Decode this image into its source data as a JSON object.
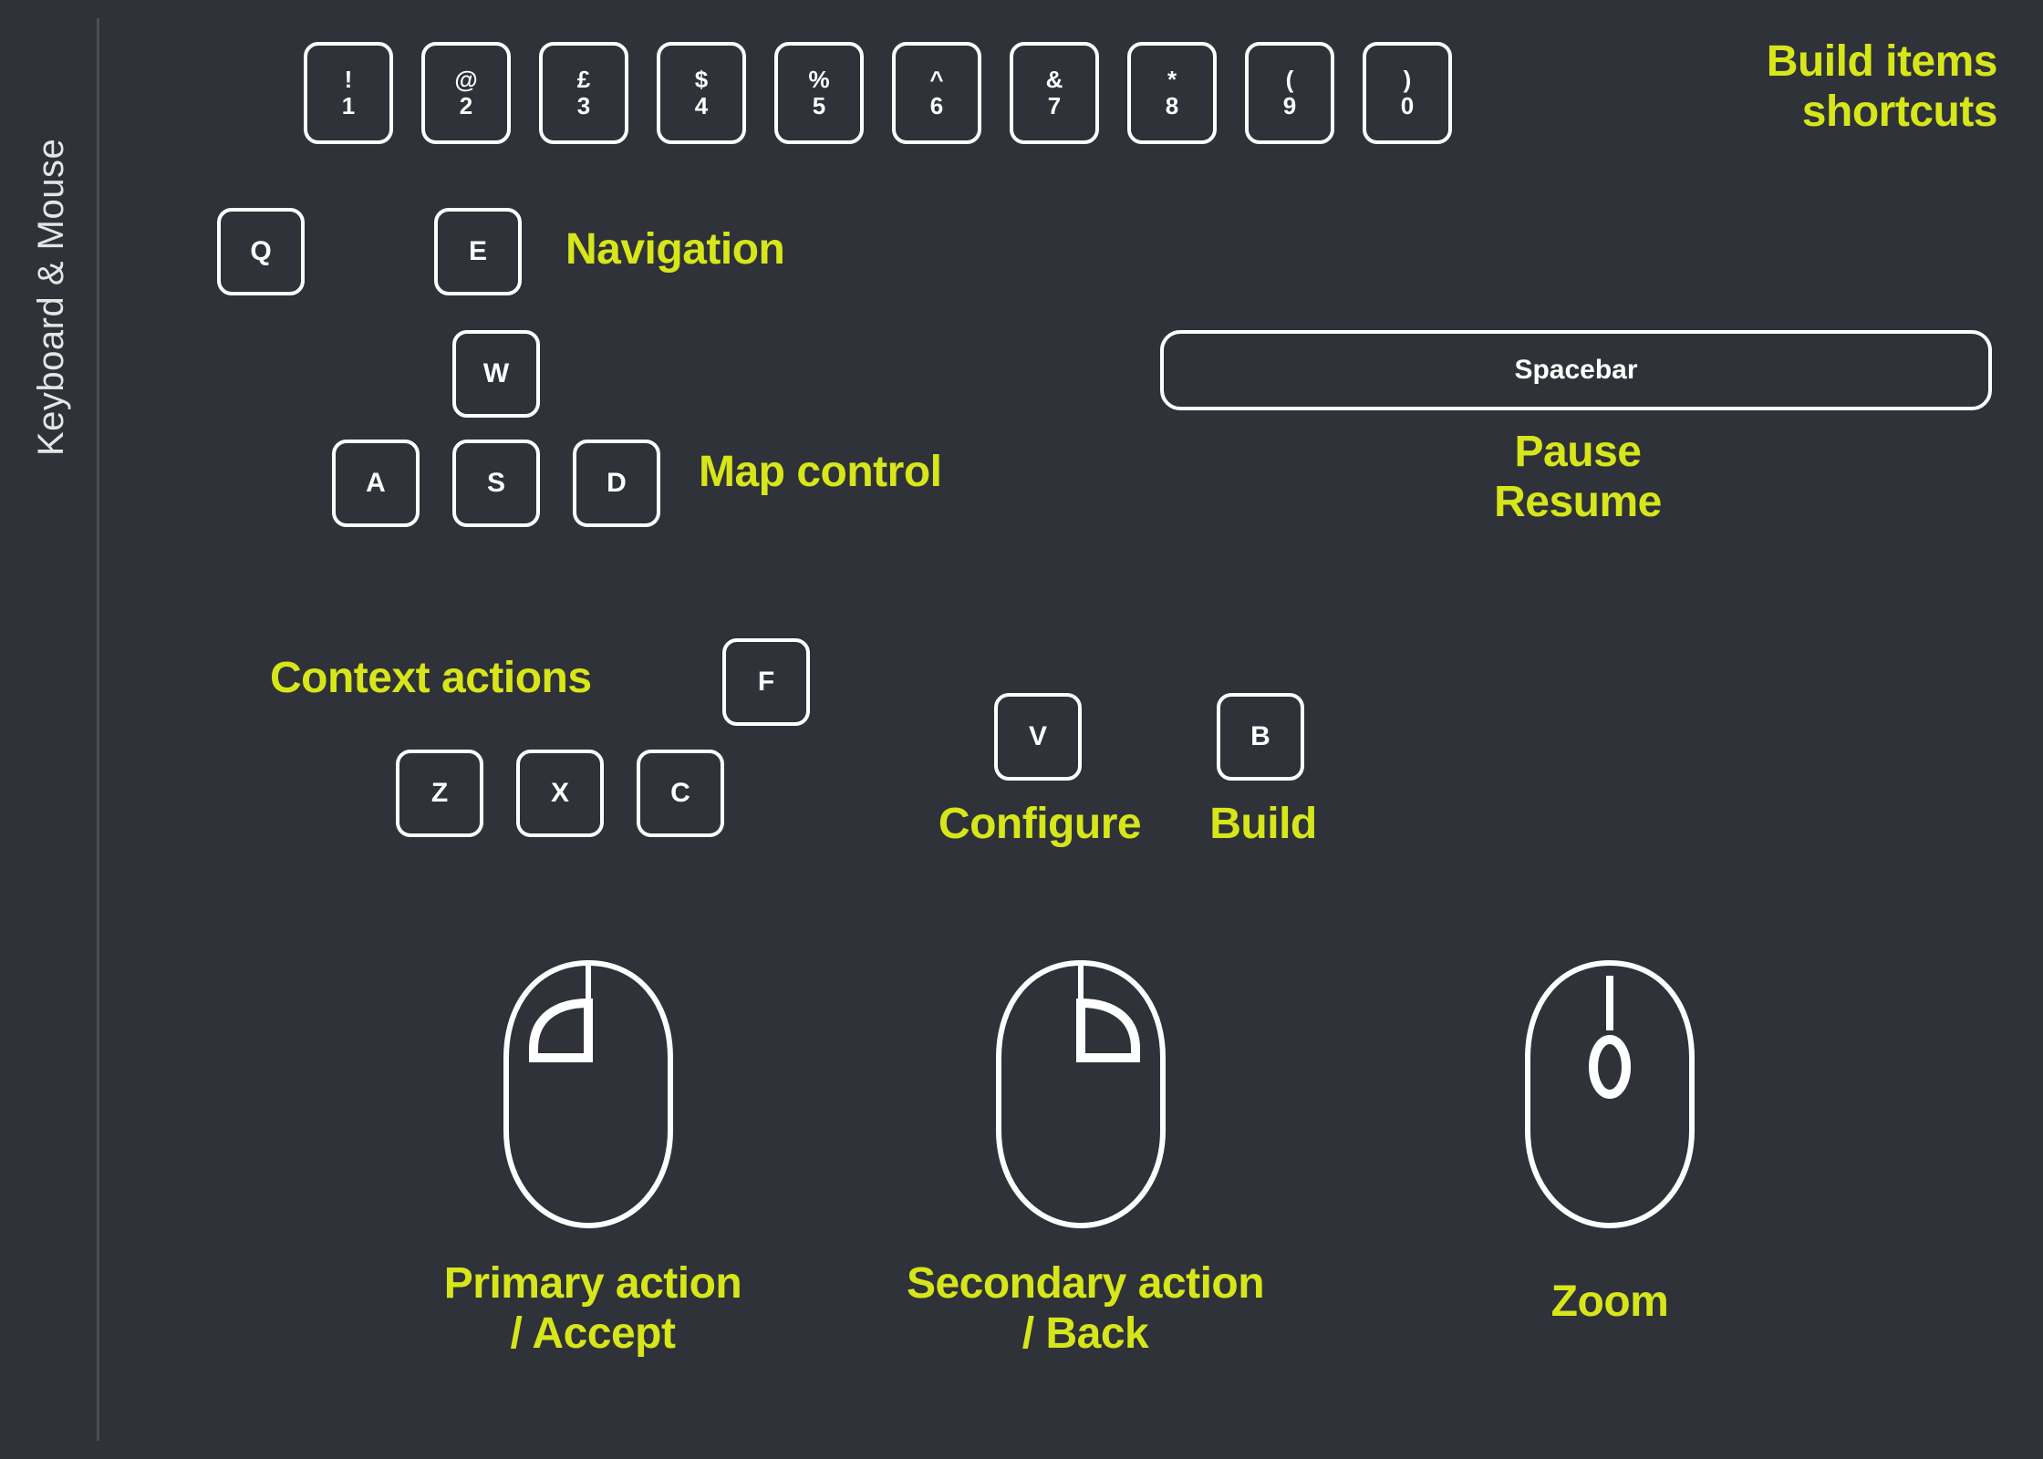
{
  "title": "Keyboard & Mouse",
  "numberRow": {
    "keys": [
      {
        "upper": "!",
        "lower": "1"
      },
      {
        "upper": "@",
        "lower": "2"
      },
      {
        "upper": "£",
        "lower": "3"
      },
      {
        "upper": "$",
        "lower": "4"
      },
      {
        "upper": "%",
        "lower": "5"
      },
      {
        "upper": "^",
        "lower": "6"
      },
      {
        "upper": "&",
        "lower": "7"
      },
      {
        "upper": "*",
        "lower": "8"
      },
      {
        "upper": "(",
        "lower": "9"
      },
      {
        "upper": ")",
        "lower": "0"
      }
    ],
    "label_line1": "Build items",
    "label_line2": "shortcuts"
  },
  "navigation": {
    "keys": {
      "q": "Q",
      "e": "E"
    },
    "label": "Navigation"
  },
  "mapControl": {
    "keys": {
      "w": "W",
      "a": "A",
      "s": "S",
      "d": "D"
    },
    "label": "Map control"
  },
  "spacebar": {
    "key": "Spacebar",
    "label_line1": "Pause",
    "label_line2": "Resume"
  },
  "contextActions": {
    "label": "Context actions",
    "keys": {
      "f": "F",
      "z": "Z",
      "x": "X",
      "c": "C"
    }
  },
  "configure": {
    "key": "V",
    "label": "Configure"
  },
  "build": {
    "key": "B",
    "label": "Build"
  },
  "mouse": {
    "left": {
      "label_line1": "Primary action",
      "label_line2": "/ Accept"
    },
    "right": {
      "label_line1": "Secondary action",
      "label_line2": "/ Back"
    },
    "scroll": {
      "label": "Zoom"
    }
  }
}
